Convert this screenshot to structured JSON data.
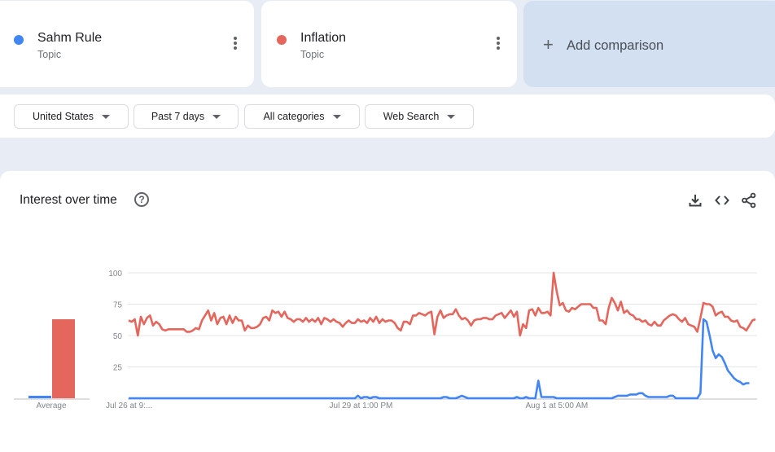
{
  "terms": [
    {
      "name": "Sahm Rule",
      "type": "Topic",
      "color": "#4285f4",
      "more_icon": "more-vert-icon"
    },
    {
      "name": "Inflation",
      "type": "Topic",
      "color": "#e5665c",
      "more_icon": "more-vert-icon"
    }
  ],
  "add_comparison": {
    "label": "Add comparison",
    "icon": "plus-icon"
  },
  "filters": [
    {
      "label": "United States",
      "icon": "caret-down-icon"
    },
    {
      "label": "Past 7 days",
      "icon": "caret-down-icon"
    },
    {
      "label": "All categories",
      "icon": "caret-down-icon"
    },
    {
      "label": "Web Search",
      "icon": "caret-down-icon"
    }
  ],
  "panel": {
    "title": "Interest over time",
    "help_icon": "help-circle-icon",
    "help_glyph": "?",
    "actions": [
      "download-icon",
      "embed-code-icon",
      "share-icon"
    ]
  },
  "chart_data": {
    "type": "line",
    "title": "Interest over time",
    "xlabel": "",
    "ylabel": "",
    "ylim": [
      0,
      100
    ],
    "yticks": [
      25,
      50,
      75,
      100
    ],
    "ytick_labels": [
      "25",
      "50",
      "75",
      "100"
    ],
    "grid": true,
    "legend": "top (term cards)",
    "x_tick_labels": [
      {
        "label": "Jul 26 at 9:...",
        "index": 0
      },
      {
        "label": "Jul 29 at 1:00 PM",
        "index": 76
      },
      {
        "label": "Aug 1 at 5:00 AM",
        "index": 140
      }
    ],
    "n_points": 168,
    "average": {
      "label": "Average",
      "values": [
        {
          "name": "Sahm Rule",
          "value": 2
        },
        {
          "name": "Inflation",
          "value": 63
        }
      ]
    },
    "series": [
      {
        "name": "Inflation",
        "color": "#e5665c",
        "values": [
          62,
          61,
          63,
          50,
          65,
          59,
          64,
          66,
          58,
          61,
          59,
          55,
          54,
          55,
          55,
          55,
          55,
          55,
          55,
          53,
          53,
          54,
          56,
          55,
          62,
          66,
          70,
          62,
          68,
          59,
          64,
          65,
          59,
          66,
          60,
          65,
          62,
          62,
          54,
          58,
          56,
          56,
          57,
          59,
          64,
          65,
          62,
          70,
          68,
          69,
          65,
          69,
          64,
          63,
          61,
          63,
          63,
          61,
          64,
          61,
          63,
          61,
          64,
          59,
          64,
          63,
          61,
          63,
          61,
          60,
          57,
          60,
          62,
          60,
          60,
          63,
          61,
          62,
          60,
          64,
          61,
          65,
          60,
          63,
          61,
          62,
          62,
          60,
          56,
          54,
          61,
          61,
          59,
          66,
          66,
          68,
          67,
          66,
          68,
          69,
          51,
          65,
          70,
          64,
          66,
          67,
          67,
          71,
          66,
          63,
          64,
          62,
          58,
          62,
          63,
          63,
          64,
          64,
          63,
          63,
          66,
          67,
          68,
          64,
          67,
          70,
          65,
          69,
          50,
          59,
          56,
          70,
          71,
          66,
          72,
          68,
          68,
          69,
          66,
          100,
          85,
          74,
          76,
          70,
          69,
          72,
          71,
          73,
          75,
          75,
          75,
          75,
          72,
          72,
          62,
          62,
          59,
          72,
          80,
          76,
          70,
          77,
          68,
          70,
          67,
          66,
          63,
          63,
          61,
          62,
          59,
          58,
          61,
          58,
          58,
          62,
          64,
          66,
          67,
          66,
          63,
          61,
          64,
          59,
          58,
          57,
          53,
          64,
          76,
          75,
          75,
          73,
          66,
          68,
          69,
          65,
          65,
          62,
          61,
          62,
          57,
          56,
          54,
          58,
          62,
          63
        ]
      },
      {
        "name": "Sahm Rule",
        "color": "#4285f4",
        "values": [
          0,
          0,
          0,
          0,
          0,
          0,
          0,
          0,
          0,
          0,
          0,
          0,
          0,
          0,
          0,
          0,
          0,
          0,
          0,
          0,
          0,
          0,
          0,
          0,
          0,
          0,
          0,
          0,
          0,
          0,
          0,
          0,
          0,
          0,
          0,
          0,
          0,
          0,
          0,
          0,
          0,
          0,
          0,
          0,
          0,
          0,
          0,
          0,
          0,
          0,
          0,
          0,
          0,
          0,
          0,
          0,
          0,
          0,
          0,
          0,
          0,
          0,
          0,
          0,
          0,
          0,
          0,
          0,
          0,
          0,
          0,
          0,
          0,
          0,
          0,
          2,
          0,
          1,
          1,
          0,
          1,
          1,
          0,
          0,
          0,
          0,
          0,
          0,
          0,
          0,
          0,
          0,
          0,
          0,
          0,
          0,
          0,
          0,
          0,
          0,
          0,
          0,
          0,
          1,
          1,
          0,
          0,
          0,
          1,
          2,
          1,
          0,
          0,
          0,
          0,
          0,
          0,
          0,
          0,
          0,
          0,
          0,
          0,
          0,
          0,
          0,
          0,
          1,
          0,
          0,
          1,
          0,
          0,
          0,
          14,
          1,
          1,
          1,
          1,
          1,
          0,
          0,
          0,
          0,
          0,
          0,
          0,
          0,
          0,
          0,
          0,
          0,
          0,
          0,
          0,
          0,
          0,
          0,
          0,
          1,
          2,
          2,
          2,
          2,
          3,
          3,
          3,
          4,
          4,
          2,
          1,
          1,
          1,
          1,
          1,
          1,
          1,
          2,
          2,
          0,
          0,
          0,
          0,
          0,
          0,
          0,
          0,
          4,
          63,
          61,
          50,
          38,
          32,
          35,
          33,
          28,
          22,
          19,
          16,
          14,
          13,
          11,
          12,
          12
        ]
      }
    ]
  }
}
